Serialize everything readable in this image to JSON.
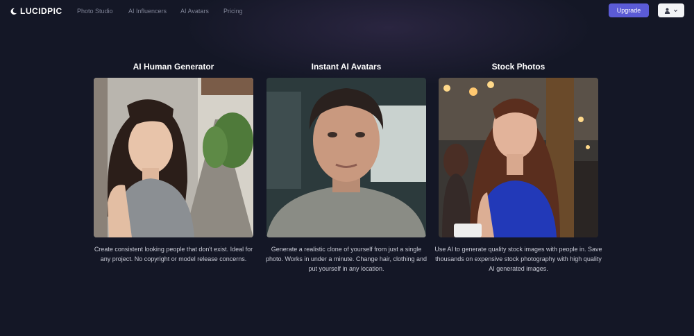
{
  "brand": {
    "name": "LUCIDPIC"
  },
  "nav": {
    "links": [
      "Photo Studio",
      "AI Influencers",
      "AI Avatars",
      "Pricing"
    ],
    "upgrade_label": "Upgrade"
  },
  "colors": {
    "accent": "#5b5bd6",
    "background": "#141726"
  },
  "icons": {
    "logo": "moon-icon",
    "user": "user-icon",
    "dropdown": "chevron-down-icon"
  },
  "cards": [
    {
      "title": "AI Human Generator",
      "description": "Create consistent looking people that don't exist. Ideal for any project. No copyright or model release concerns."
    },
    {
      "title": "Instant AI Avatars",
      "description": "Generate a realistic clone of yourself from just a single photo. Works in under a minute. Change hair, clothing and put yourself in any location."
    },
    {
      "title": "Stock Photos",
      "description": "Use AI to generate quality stock images with people in. Save thousands on expensive stock photography with high quality AI generated images."
    }
  ]
}
